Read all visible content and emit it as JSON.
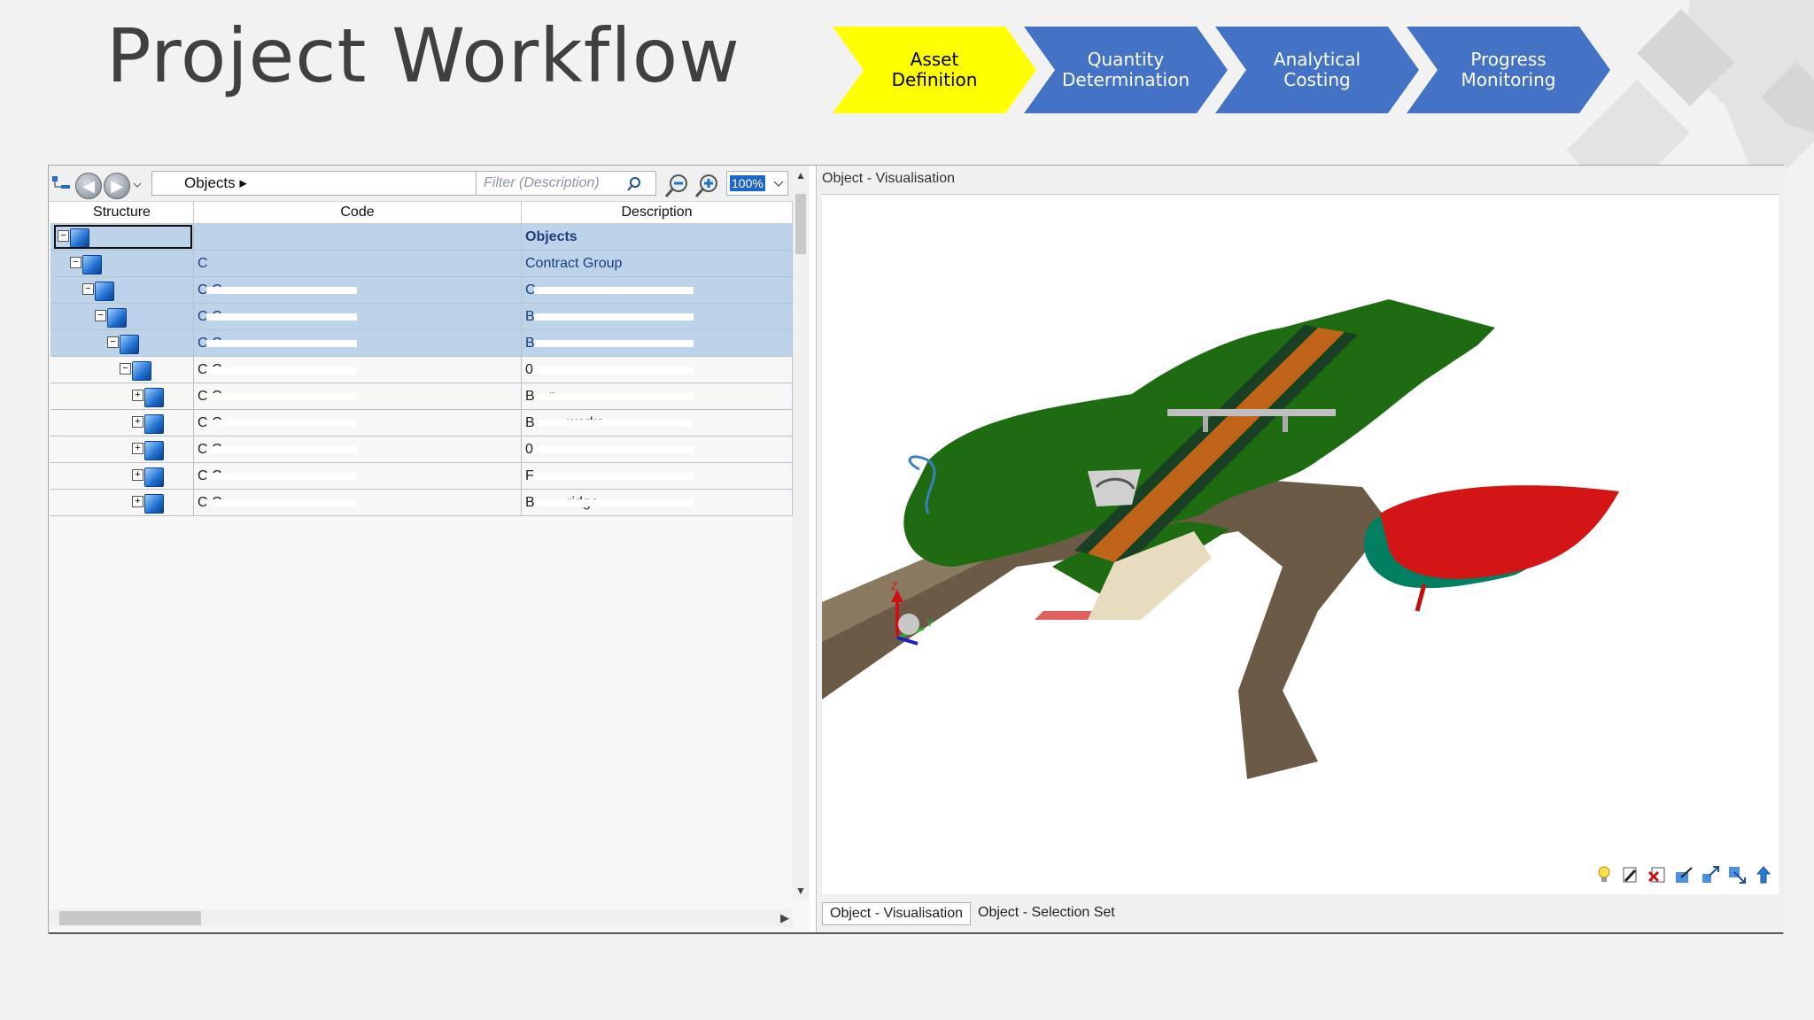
{
  "slide": {
    "title": "Project Workflow",
    "workflow": [
      {
        "label": "Asset\nDefinition",
        "active": true
      },
      {
        "label": "Quantity\nDetermination",
        "active": false
      },
      {
        "label": "Analytical\nCosting",
        "active": false
      },
      {
        "label": "Progress\nMonitoring",
        "active": false
      }
    ]
  },
  "toolbar": {
    "breadcrumb": "Objects",
    "filter_placeholder": "Filter (Description)",
    "zoom": "100%"
  },
  "grid": {
    "columns": [
      "Structure",
      "Code",
      "Description"
    ],
    "rows": [
      {
        "level": 0,
        "expander": "−",
        "code": "",
        "desc": "Objects",
        "desc_bold": true,
        "highlight": true,
        "selected": true
      },
      {
        "level": 1,
        "expander": "−",
        "code": "C",
        "desc": "Contract Group",
        "highlight": true
      },
      {
        "level": 2,
        "expander": "−",
        "code": "C.C…",
        "desc": "C…",
        "highlight": true
      },
      {
        "level": 3,
        "expander": "−",
        "code": "C.C…",
        "desc": "B…",
        "highlight": true
      },
      {
        "level": 4,
        "expander": "−",
        "code": "C.C…",
        "desc": "B…",
        "highlight": true
      },
      {
        "level": 5,
        "expander": "−",
        "code": "C.C…",
        "desc": "0…",
        "highlight": false
      },
      {
        "level": 6,
        "expander": "+",
        "code": "C.C…",
        "desc": "B…n",
        "highlight": false
      },
      {
        "level": 6,
        "expander": "+",
        "code": "C.C…",
        "desc": "B… …works",
        "highlight": false
      },
      {
        "level": 6,
        "expander": "+",
        "code": "C.C…",
        "desc": "0…",
        "highlight": false
      },
      {
        "level": 6,
        "expander": "+",
        "code": "C.C…",
        "desc": "F…",
        "highlight": false
      },
      {
        "level": 6,
        "expander": "+",
        "code": "C.C…",
        "desc": "B… …ridge",
        "highlight": false
      }
    ]
  },
  "viewer": {
    "title": "Object - Visualisation",
    "tabs": [
      "Object - Visualisation",
      "Object - Selection Set"
    ]
  },
  "icons": [
    "back-icon",
    "forward-icon",
    "objects-icon",
    "search-icon",
    "zoom-out-icon",
    "zoom-in-icon",
    "axis-gizmo-icon",
    "light-icon"
  ],
  "colors": {
    "accent": "#4472c4",
    "active_step": "#ffff00",
    "terrain": "#1e6b12",
    "road": "#c0641a",
    "selection": "#bcd3ea"
  }
}
